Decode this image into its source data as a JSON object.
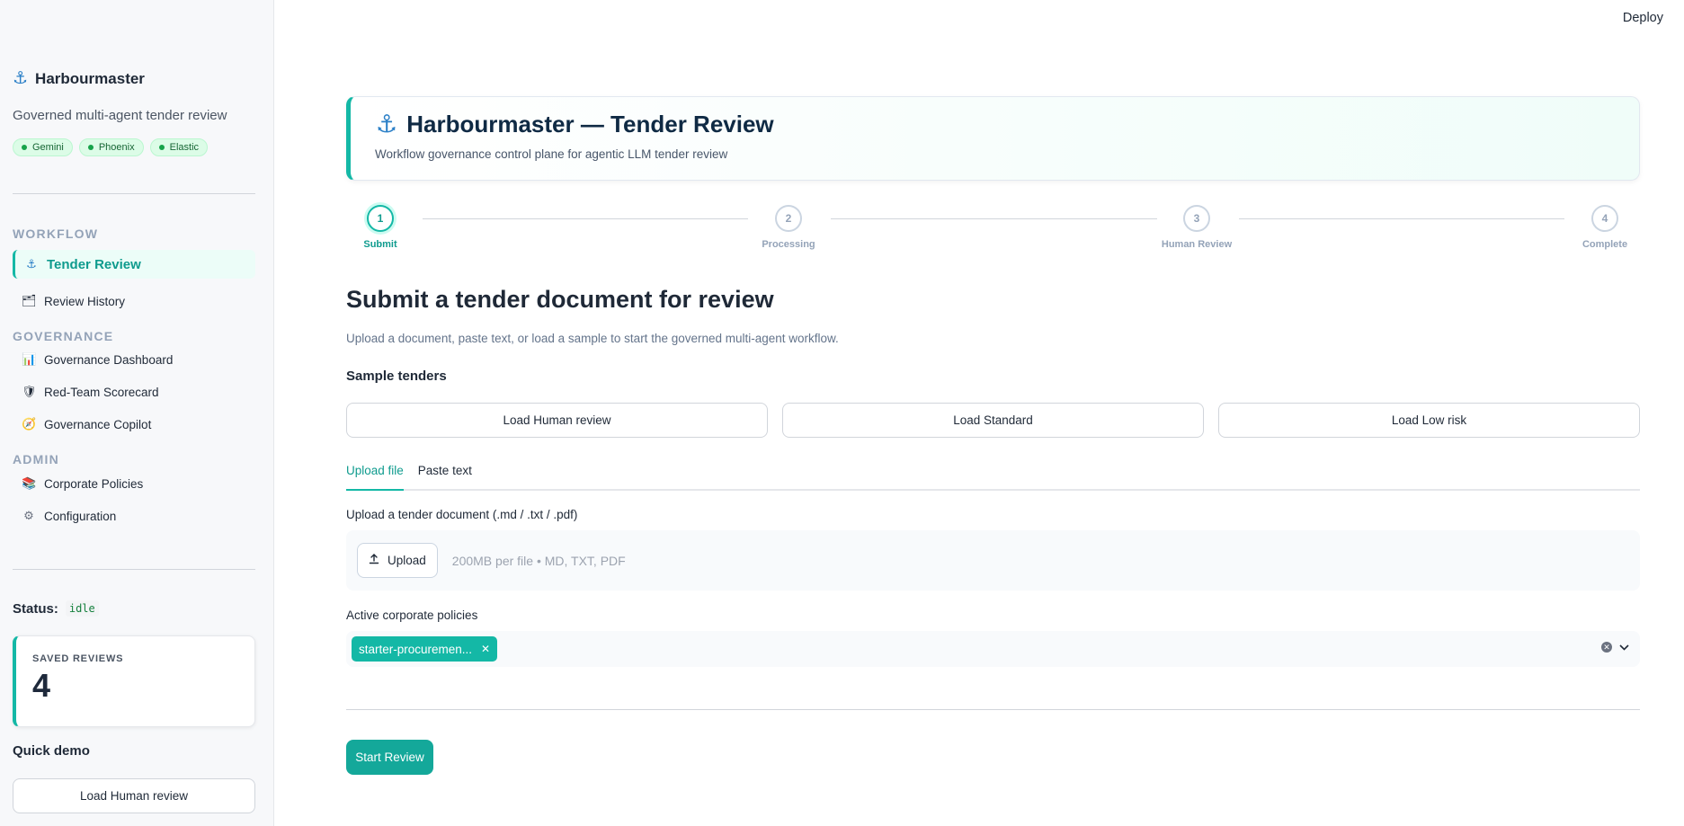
{
  "topbar": {
    "deploy_label": "Deploy"
  },
  "sidebar": {
    "brand_icon": "⚓",
    "brand_name": "Harbourmaster",
    "tagline": "Governed multi-agent tender review",
    "chips": [
      "Gemini",
      "Phoenix",
      "Elastic"
    ],
    "sections": {
      "workflow": "WORKFLOW",
      "governance": "GOVERNANCE",
      "admin": "ADMIN"
    },
    "items": [
      {
        "label": "Tender Review",
        "icon": "anchor-icon",
        "glyph": "⚓"
      },
      {
        "label": "Review History",
        "icon": "folder-icon",
        "glyph": "🗂"
      },
      {
        "label": "Governance Dashboard",
        "icon": "bar-chart-icon",
        "glyph": "📊"
      },
      {
        "label": "Red-Team Scorecard",
        "icon": "shield-icon",
        "glyph": "🛡"
      },
      {
        "label": "Governance Copilot",
        "icon": "compass-icon",
        "glyph": "🧭"
      },
      {
        "label": "Corporate Policies",
        "icon": "books-icon",
        "glyph": "📚"
      },
      {
        "label": "Configuration",
        "icon": "gear-icon",
        "glyph": "⚙"
      }
    ],
    "status_label": "Status:",
    "status_value": "idle",
    "saved_reviews": {
      "label": "SAVED REVIEWS",
      "count": "4"
    },
    "quick_demo": {
      "heading": "Quick demo",
      "button": "Load Human review"
    }
  },
  "main": {
    "hero": {
      "icon": "⚓",
      "title": "Harbourmaster — Tender Review",
      "subtitle": "Workflow governance control plane for agentic LLM tender review"
    },
    "stepper": {
      "current": 1,
      "steps": [
        {
          "number": "1",
          "label": "Submit"
        },
        {
          "number": "2",
          "label": "Processing"
        },
        {
          "number": "3",
          "label": "Human Review"
        },
        {
          "number": "4",
          "label": "Complete"
        }
      ]
    },
    "title": "Submit a tender document for review",
    "subtitle": "Upload a document, paste text, or load a sample to start the governed multi-agent workflow.",
    "samples": {
      "heading": "Sample tenders",
      "buttons": [
        "Load Human review",
        "Load Standard",
        "Load Low risk"
      ]
    },
    "tabs": [
      {
        "label": "Upload file",
        "active": true
      },
      {
        "label": "Paste text",
        "active": false
      }
    ],
    "upload": {
      "label": "Upload a tender document (.md / .txt / .pdf)",
      "button": "Upload",
      "hint": "200MB per file • MD, TXT, PDF"
    },
    "policies": {
      "label": "Active corporate policies",
      "selected": [
        "starter-procuremen..."
      ]
    },
    "start_button": "Start Review"
  },
  "colors": {
    "accent": "#14b8a6",
    "accent_dark": "#0f9b8e",
    "chip_bg": "#dcfce7",
    "brand_icon": "#2a7fc7"
  }
}
